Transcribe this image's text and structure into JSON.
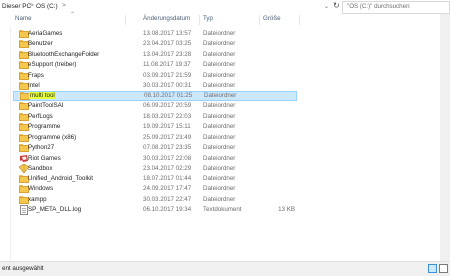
{
  "address": {
    "crumbs": [
      "Dieser PC",
      "OS (C:)"
    ],
    "separator": ">",
    "search_placeholder": "\"OS (C:)\" durchsuchen"
  },
  "columns": {
    "name": "Name",
    "date": "Änderungsdatum",
    "type": "Typ",
    "size": "Größe"
  },
  "rows": [
    {
      "name": "AeriaGames",
      "date": "13.08.2017 13:57",
      "type": "Dateiordner",
      "size": ""
    },
    {
      "name": "Benutzer",
      "date": "23.04.2017 03:25",
      "type": "Dateiordner",
      "size": ""
    },
    {
      "name": "BluetoothExchangeFolder",
      "date": "13.04.2017 23:28",
      "type": "Dateiordner",
      "size": ""
    },
    {
      "name": "eSupport (treiber)",
      "date": "11.08.2017 19:37",
      "type": "Dateiordner",
      "size": ""
    },
    {
      "name": "Fraps",
      "date": "03.09.2017 21:59",
      "type": "Dateiordner",
      "size": ""
    },
    {
      "name": "Intel",
      "date": "30.03.2017 00:31",
      "type": "Dateiordner",
      "size": ""
    },
    {
      "name": "multi tool",
      "date": "08.10.2017 01:25",
      "type": "Dateiordner",
      "size": ""
    },
    {
      "name": "PaintToolSAI",
      "date": "06.09.2017 20:59",
      "type": "Dateiordner",
      "size": ""
    },
    {
      "name": "PerfLogs",
      "date": "18.03.2017 22:03",
      "type": "Dateiordner",
      "size": ""
    },
    {
      "name": "Programme",
      "date": "19.09.2017 15:11",
      "type": "Dateiordner",
      "size": ""
    },
    {
      "name": "Programme (x86)",
      "date": "25.09.2017 23:49",
      "type": "Dateiordner",
      "size": ""
    },
    {
      "name": "Python27",
      "date": "07.08.2017 23:35",
      "type": "Dateiordner",
      "size": ""
    },
    {
      "name": "Riot Games",
      "date": "30.03.2017 22:08",
      "type": "Dateiordner",
      "size": ""
    },
    {
      "name": "Sandbox",
      "date": "23.04.2017 02:29",
      "type": "Dateiordner",
      "size": ""
    },
    {
      "name": "Unified_Android_Toolkit",
      "date": "18.07.2017 01:44",
      "type": "Dateiordner",
      "size": ""
    },
    {
      "name": "Windows",
      "date": "24.09.2017 17:47",
      "type": "Dateiordner",
      "size": ""
    },
    {
      "name": "xampp",
      "date": "30.03.2017 22:47",
      "type": "Dateiordner",
      "size": ""
    },
    {
      "name": "SP_META_DLL.log",
      "date": "06.10.2017 19:34",
      "type": "Textdokument",
      "size": "13 KB"
    }
  ],
  "selected_index": 6,
  "status": {
    "text": "ent ausgewählt"
  },
  "colors": {
    "selection": "#cce8ff",
    "highlight": "#e6ff3b",
    "folder": "#f5c84d"
  }
}
